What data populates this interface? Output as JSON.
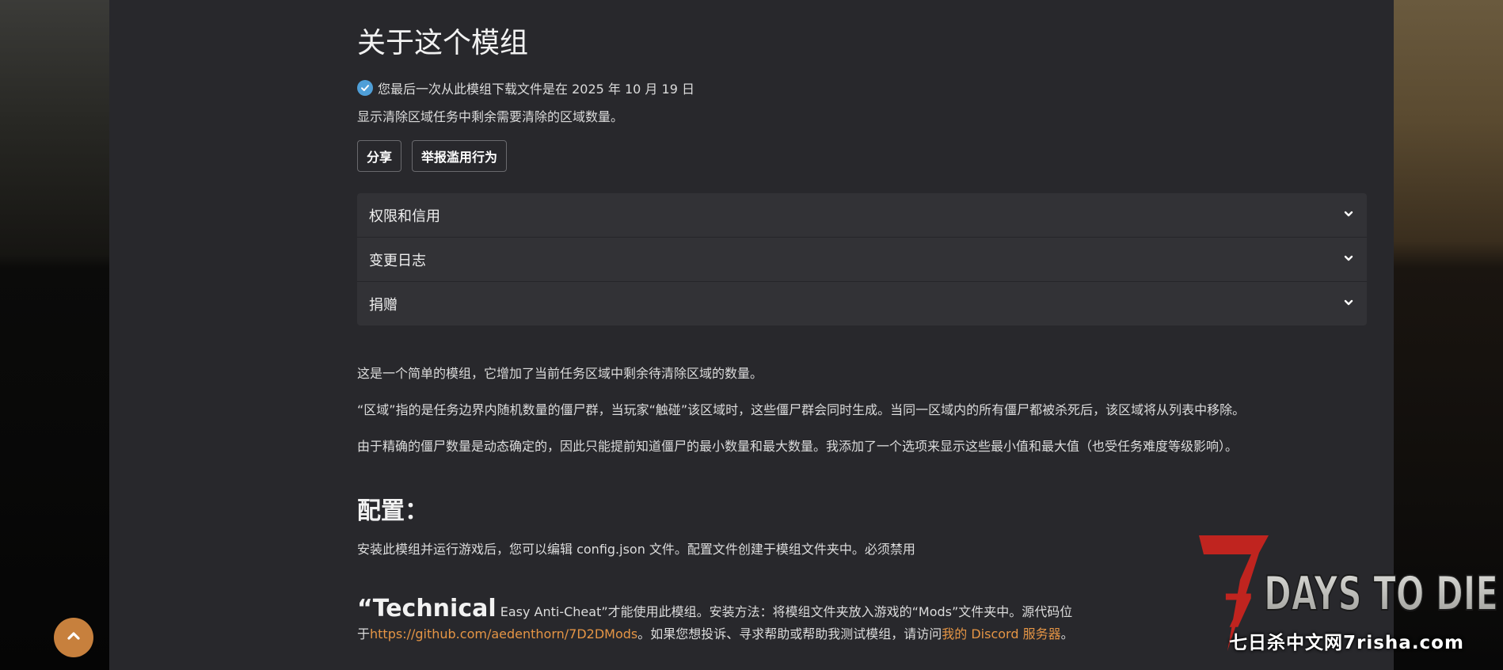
{
  "title": "关于这个模组",
  "download_notice": "您最后一次从此模组下载文件是在 2025 年 10 月 19 日",
  "summary": "显示清除区域任务中剩余需要清除的区域数量。",
  "buttons": {
    "share": "分享",
    "report": "举报滥用行为"
  },
  "accordion": [
    "权限和信用",
    "变更日志",
    "捐赠"
  ],
  "description": {
    "p1": "这是一个简单的模组，它增加了当前任务区域中剩余待清除区域的数量。",
    "p2": "“区域”指的是任务边界内随机数量的僵尸群，当玩家“触碰”该区域时，这些僵尸群会同时生成。当同一区域内的所有僵尸都被杀死后，该区域将从列表中移除。",
    "p3": "由于精确的僵尸数量是动态确定的，因此只能提前知道僵尸的最小数量和最大数量。我添加了一个选项来显示这些最小值和最大值（也受任务难度等级影响）。"
  },
  "config": {
    "heading": "配置：",
    "text": "安装此模组并运行游戏后，您可以编辑 config.json 文件。配置文件创建于模组文件夹中。必须禁用"
  },
  "technical": {
    "big": "“Technical",
    "rest": " Easy Anti-Cheat”才能使用此模组。安装方法：将模组文件夹放入游戏的“Mods”文件夹中。源代码位",
    "line2_prefix": "于",
    "github_link": "https://github.com/aedenthorn/7D2DMods",
    "line2_mid": "。如果您想投诉、寻求帮助或帮助我测试模组，请访问",
    "discord_link": "我的 Discord 服务器",
    "line2_suffix": "。"
  },
  "logo": {
    "seven": "7",
    "text": "DAYS TO DIE",
    "watermark": "七日杀中文网7risha.com"
  },
  "colors": {
    "accent": "#e59545",
    "check": "#4f9fd8",
    "panel": "#28282c",
    "scroll_button": "#c7803d"
  },
  "icons": {
    "verified": "check-circle-icon",
    "chevron": "chevron-down-icon",
    "scroll_top": "chevron-up-icon"
  }
}
